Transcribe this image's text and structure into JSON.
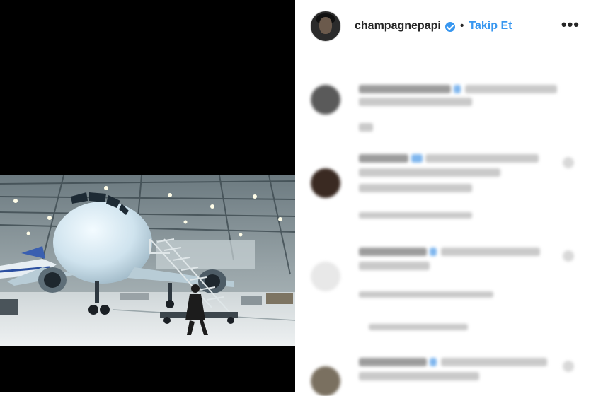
{
  "post": {
    "username": "champagnepapi",
    "separator": "•",
    "follow_label": "Takip Et",
    "more_label": "•••"
  },
  "colors": {
    "accent": "#3897f0",
    "media_background": "#000000"
  },
  "media": {
    "icon": "airplane-hangar-photo"
  },
  "comments": [
    {
      "avatar_color": "#5a5a5a"
    },
    {
      "avatar_color": "#3a2a22"
    },
    {
      "avatar_color": "#e8e8e8"
    },
    {
      "avatar_color": "#7a7060"
    }
  ]
}
